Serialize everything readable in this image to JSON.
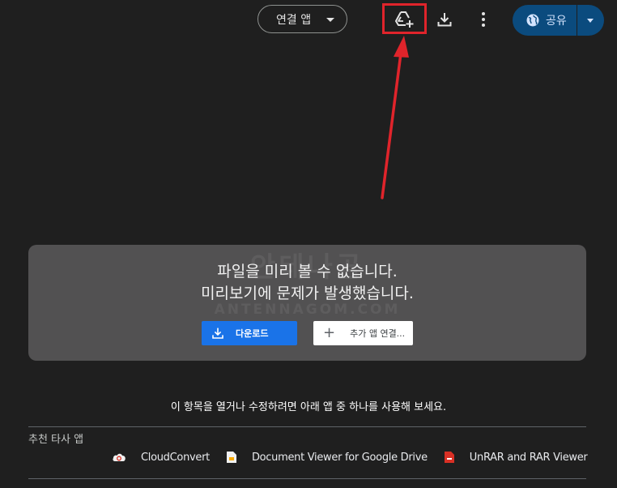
{
  "toolbar": {
    "open_with_label": "연결 앱",
    "share_label": "공유"
  },
  "icons": {
    "add_shortcut": "add-to-drive-icon",
    "download": "download-icon",
    "more": "more-vert-icon",
    "share": "globe-icon"
  },
  "colors": {
    "background": "#1f1f1f",
    "share_button": "#0b4b7e",
    "download_button": "#1a73e8",
    "highlight": "#e0242b",
    "card": "#525152"
  },
  "preview_error": {
    "line1": "파일을 미리 볼 수 없습니다.",
    "line2": "미리보기에 문제가 발생했습니다.",
    "download_label": "다운로드",
    "add_app_label": "추가 앱 연결..."
  },
  "open_hint": "이 항목을 열거나 수정하려면 아래 앱 중 하나를 사용해 보세요.",
  "recommended": {
    "label": "추천 타사 앱",
    "apps": [
      {
        "name": "CloudConvert"
      },
      {
        "name": "Document Viewer for Google Drive"
      },
      {
        "name": "UnRAR and RAR Viewer"
      }
    ]
  }
}
